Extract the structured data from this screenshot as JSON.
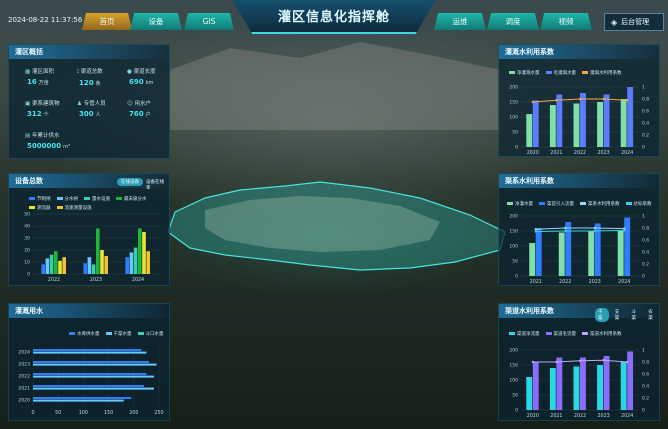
{
  "header": {
    "timestamp": "2024-08-22 11:37:56",
    "title": "灌区信息化指挥舱",
    "nav_left": [
      "首页",
      "设备",
      "GIS"
    ],
    "nav_right": [
      "运维",
      "调度",
      "视频"
    ],
    "admin_label": "后台管理",
    "colors": {
      "active": "#d8a32e",
      "nav": "#1fb7a9",
      "accent": "#44e3f2"
    }
  },
  "overview": {
    "title": "灌区概括",
    "stats": [
      {
        "icon": "grid-icon",
        "label": "灌区面积",
        "value": "16",
        "unit": "万亩"
      },
      {
        "icon": "pipe-icon",
        "label": "渠道总数",
        "value": "120",
        "unit": "条"
      },
      {
        "icon": "drop-icon",
        "label": "渠道长度",
        "value": "690",
        "unit": "km"
      },
      {
        "icon": "building-icon",
        "label": "渠系建筑物",
        "value": "312",
        "unit": "个"
      },
      {
        "icon": "person-icon",
        "label": "专管人员",
        "value": "300",
        "unit": "人"
      },
      {
        "icon": "user-icon",
        "label": "用水户",
        "value": "760",
        "unit": "户"
      },
      {
        "icon": "calendar-icon",
        "label": "年累计供水",
        "value": "5000000",
        "unit": "m³"
      }
    ]
  },
  "device_panel": {
    "title": "设备总数",
    "toggle_labels": [
      "在线设备",
      "设备在线率"
    ],
    "legend": [
      "节制闸",
      "分水闸",
      "量水设施",
      "最末级分水",
      "测流器",
      "流速测量设施"
    ]
  },
  "water_panel": {
    "title": "灌溉用水",
    "legend": [
      "水库供水量",
      "干渠水量",
      "斗口水量"
    ]
  },
  "right_panels": [
    {
      "title": "灌溉水利用系数",
      "legend": [
        "净灌溉水量",
        "毛灌溉水量",
        "灌溉水利用系数"
      ]
    },
    {
      "title": "渠系水利用系数",
      "legend": [
        "净灌水量",
        "渠首引入流量",
        "渠系水利用系数",
        "达标系数"
      ]
    },
    {
      "title": "渠道水利用系数",
      "toggle_labels": [
        "干渠",
        "支渠",
        "斗渠",
        "农渠"
      ],
      "legend": [
        "渠道净流量",
        "渠道毛流量",
        "渠道水利用系数"
      ]
    }
  ],
  "chart_data": [
    {
      "type": "bar",
      "title": "设备总数",
      "categories": [
        "2022",
        "2023",
        "2024"
      ],
      "ylim": [
        0,
        50
      ],
      "yticks": [
        "0",
        "10",
        "20",
        "30",
        "40",
        "50"
      ],
      "series": [
        {
          "name": "节制闸",
          "color": "#2f7cff",
          "values": [
            8,
            9,
            14
          ]
        },
        {
          "name": "分水闸",
          "color": "#67c8ff",
          "values": [
            13,
            14,
            18
          ]
        },
        {
          "name": "量水设施",
          "color": "#38d0a5",
          "values": [
            16,
            8,
            22
          ]
        },
        {
          "name": "最末级分水",
          "color": "#1fb43b",
          "values": [
            19,
            38,
            38
          ]
        },
        {
          "name": "测流器",
          "color": "#e6e63a",
          "values": [
            11,
            20,
            35
          ]
        },
        {
          "name": "流速测量设施",
          "color": "#f2c230",
          "values": [
            14,
            15,
            19
          ]
        }
      ]
    },
    {
      "type": "bar",
      "orientation": "horizontal",
      "title": "灌溉用水",
      "categories": [
        "2020",
        "2021",
        "2022",
        "2023",
        "2024"
      ],
      "xlim": [
        0,
        250
      ],
      "xticks": [
        "0",
        "50",
        "100",
        "150",
        "200",
        "250"
      ],
      "series": [
        {
          "name": "水库供水量",
          "color": "#2f7cff",
          "values": [
            195,
            220,
            225,
            230,
            215
          ]
        },
        {
          "name": "干渠水量",
          "color": "#67c8ff",
          "values": [
            180,
            240,
            240,
            245,
            225
          ]
        },
        {
          "name": "斗口水量",
          "color": "#38d0a5",
          "values": [
            0,
            0,
            0,
            0,
            0
          ]
        }
      ]
    },
    {
      "type": "bar",
      "title": "灌溉水利用系数",
      "categories": [
        "2020",
        "2021",
        "2022",
        "2023",
        "2024"
      ],
      "ylim": [
        0,
        200
      ],
      "y2lim": [
        0,
        1
      ],
      "yticks": [
        "0",
        "50",
        "100",
        "150",
        "200"
      ],
      "y2ticks": [
        "0",
        "0.2",
        "0.4",
        "0.6",
        "0.8",
        "1"
      ],
      "series": [
        {
          "name": "净灌溉水量",
          "color": "#7ee0a8",
          "values": [
            110,
            140,
            145,
            150,
            160
          ]
        },
        {
          "name": "毛灌溉水量",
          "color": "#5b7cff",
          "values": [
            155,
            175,
            180,
            175,
            200
          ]
        },
        {
          "name": "灌溉水利用系数",
          "color": "#f3a64a",
          "type": "line",
          "values": [
            0.75,
            0.78,
            0.8,
            0.8,
            0.78
          ]
        }
      ]
    },
    {
      "type": "bar",
      "title": "渠系水利用系数",
      "categories": [
        "2021",
        "2022",
        "2023",
        "2024"
      ],
      "ylim": [
        0,
        200
      ],
      "y2lim": [
        0,
        1
      ],
      "yticks": [
        "0",
        "50",
        "100",
        "150",
        "200"
      ],
      "y2ticks": [
        "0",
        "0.2",
        "0.4",
        "0.6",
        "0.8",
        "1"
      ],
      "series": [
        {
          "name": "净灌水量",
          "color": "#7ee0a8",
          "values": [
            110,
            145,
            150,
            150
          ]
        },
        {
          "name": "渠首引入流量",
          "color": "#2f7cff",
          "values": [
            160,
            180,
            175,
            195
          ]
        },
        {
          "name": "渠系水利用系数",
          "color": "#9ad6ff",
          "type": "line",
          "values": [
            0.78,
            0.8,
            0.8,
            0.79
          ]
        },
        {
          "name": "达标系数",
          "color": "#38d0e5",
          "type": "line",
          "values": [
            0.74,
            0.75,
            0.75,
            0.76
          ]
        }
      ]
    },
    {
      "type": "bar",
      "title": "渠道水利用系数",
      "categories": [
        "2020",
        "2021",
        "2022",
        "2023",
        "2024"
      ],
      "ylim": [
        0,
        200
      ],
      "y2lim": [
        0,
        1
      ],
      "yticks": [
        "0",
        "50",
        "100",
        "150",
        "200"
      ],
      "y2ticks": [
        "0",
        "0.2",
        "0.4",
        "0.6",
        "0.8",
        "1"
      ],
      "series": [
        {
          "name": "渠道净流量",
          "color": "#29d7e6",
          "values": [
            110,
            140,
            145,
            150,
            160
          ]
        },
        {
          "name": "渠道毛流量",
          "color": "#8b6cff",
          "values": [
            160,
            175,
            175,
            180,
            195
          ]
        },
        {
          "name": "渠道水利用系数",
          "color": "#b9a8ff",
          "type": "line",
          "values": [
            0.8,
            0.8,
            0.82,
            0.83,
            0.8
          ]
        }
      ]
    }
  ]
}
